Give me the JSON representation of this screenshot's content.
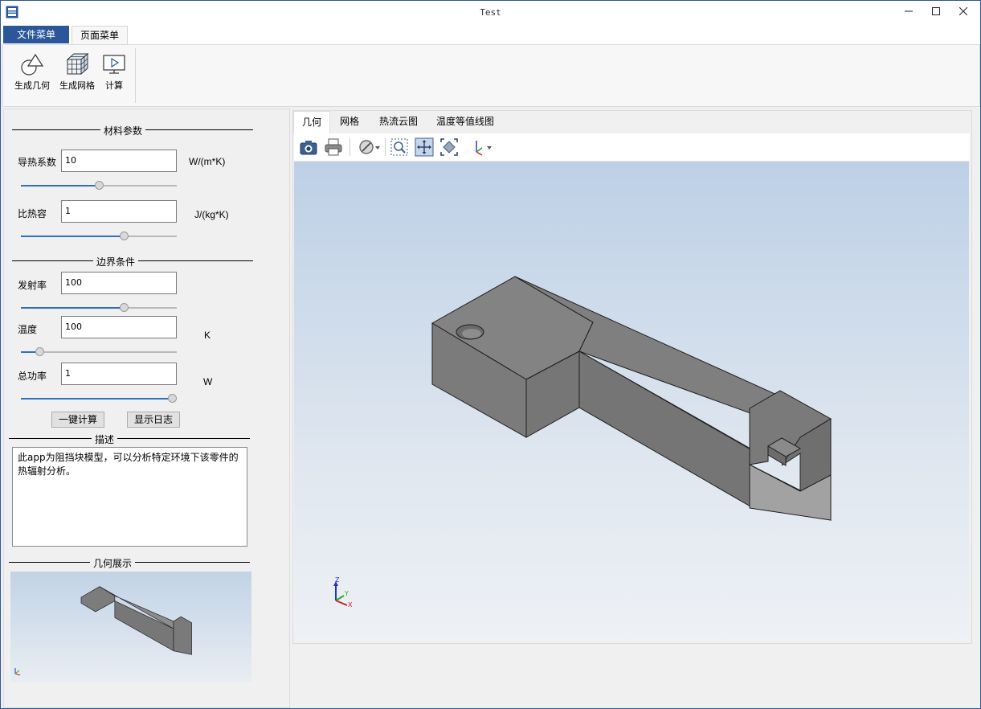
{
  "window": {
    "title": "Test"
  },
  "ribbon": {
    "tabs": [
      {
        "label": "文件菜单"
      },
      {
        "label": "页面菜单"
      }
    ],
    "buttons": [
      {
        "label": "生成几何",
        "icon": "geometry-icon"
      },
      {
        "label": "生成网格",
        "icon": "mesh-icon"
      },
      {
        "label": "计算",
        "icon": "compute-icon"
      }
    ]
  },
  "left": {
    "material": {
      "title": "材料参数",
      "conductivity": {
        "label": "导热系数",
        "value": "10",
        "unit": "W/(m*K)",
        "slider": 0.5
      },
      "heat_capacity": {
        "label": "比热容",
        "value": "1",
        "unit": "J/(kg*K)",
        "slider": 0.67
      }
    },
    "boundary": {
      "title": "边界条件",
      "emissivity": {
        "label": "发射率",
        "value": "100",
        "unit": "",
        "slider": 0.67
      },
      "temperature": {
        "label": "温度",
        "value": "100",
        "unit": "K",
        "slider": 0.1
      },
      "power": {
        "label": "总功率",
        "value": "1",
        "unit": "W",
        "slider": 1.0
      }
    },
    "buttons": {
      "compute": "一键计算",
      "show_log": "显示日志"
    },
    "description": {
      "title": "描述",
      "text": "此app为阻挡块模型，可以分析特定环境下该零件的热辐射分析。"
    },
    "preview": {
      "title": "几何展示"
    }
  },
  "viewer": {
    "tabs": [
      {
        "label": "几何"
      },
      {
        "label": "网格"
      },
      {
        "label": "热流云图"
      },
      {
        "label": "温度等值线图"
      }
    ],
    "active_tab": 0,
    "toolbar": [
      "camera-icon",
      "print-icon",
      "clip-icon",
      "zoom-window-icon",
      "pan-icon",
      "fit-all-icon",
      "axis-view-icon"
    ],
    "triad": {
      "x": "X",
      "y": "Y",
      "z": "Z"
    }
  },
  "colors": {
    "accent": "#2b579a",
    "slider_fill": "#2f6fc0",
    "part": "#7a7a7a"
  }
}
